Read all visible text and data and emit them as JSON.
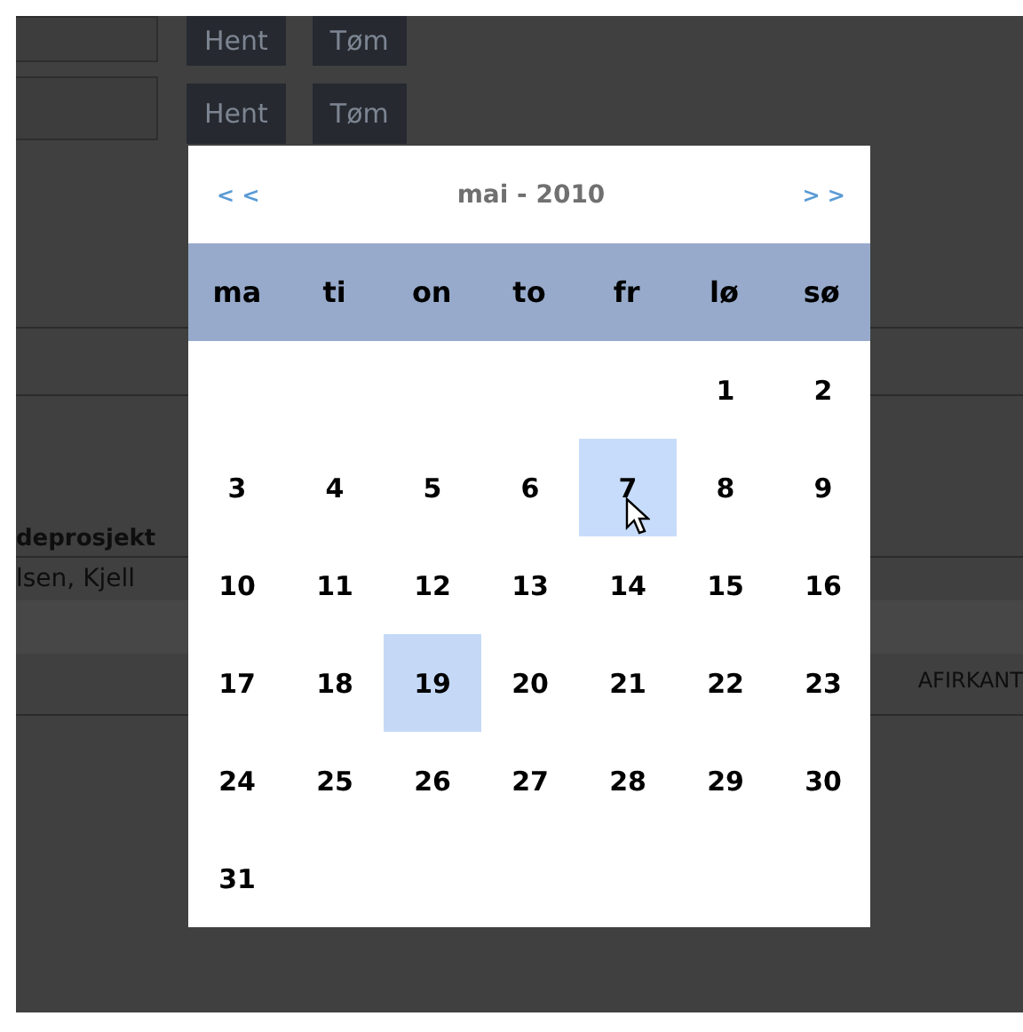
{
  "form_rows": [
    {
      "buttons": [
        "Hent",
        "Tøm"
      ]
    },
    {
      "buttons": [
        "Hent",
        "Tøm"
      ]
    }
  ],
  "background_table": {
    "header_cell": "deprosjekt",
    "cells": [
      "lsen, Kjell"
    ],
    "right_cell": "AFIRKANT"
  },
  "calendar": {
    "prev": "< <",
    "title": "mai - 2010",
    "next": "> >",
    "weekdays": [
      "ma",
      "ti",
      "on",
      "to",
      "fr",
      "lø",
      "sø"
    ],
    "weeks": [
      [
        {
          "day": "1",
          "selected": false,
          "hovered": false
        },
        {
          "day": "2",
          "selected": false,
          "hovered": false
        }
      ],
      [
        {
          "day": "3",
          "selected": false,
          "hovered": false
        },
        {
          "day": "4",
          "selected": false,
          "hovered": false
        },
        {
          "day": "5",
          "selected": false,
          "hovered": false
        },
        {
          "day": "6",
          "selected": false,
          "hovered": false
        },
        {
          "day": "7",
          "selected": false,
          "hovered": true
        },
        {
          "day": "8",
          "selected": false,
          "hovered": false
        },
        {
          "day": "9",
          "selected": false,
          "hovered": false
        }
      ],
      [
        {
          "day": "10",
          "selected": false,
          "hovered": false
        },
        {
          "day": "11",
          "selected": false,
          "hovered": false
        },
        {
          "day": "12",
          "selected": false,
          "hovered": false
        },
        {
          "day": "13",
          "selected": false,
          "hovered": false
        },
        {
          "day": "14",
          "selected": false,
          "hovered": false
        },
        {
          "day": "15",
          "selected": false,
          "hovered": false
        },
        {
          "day": "16",
          "selected": false,
          "hovered": false
        }
      ],
      [
        {
          "day": "17",
          "selected": false,
          "hovered": false
        },
        {
          "day": "18",
          "selected": false,
          "hovered": false
        },
        {
          "day": "19",
          "selected": true,
          "hovered": false
        },
        {
          "day": "20",
          "selected": false,
          "hovered": false
        },
        {
          "day": "21",
          "selected": false,
          "hovered": false
        },
        {
          "day": "22",
          "selected": false,
          "hovered": false
        },
        {
          "day": "23",
          "selected": false,
          "hovered": false
        }
      ],
      [
        {
          "day": "24",
          "selected": false,
          "hovered": false
        },
        {
          "day": "25",
          "selected": false,
          "hovered": false
        },
        {
          "day": "26",
          "selected": false,
          "hovered": false
        },
        {
          "day": "27",
          "selected": false,
          "hovered": false
        },
        {
          "day": "28",
          "selected": false,
          "hovered": false
        },
        {
          "day": "29",
          "selected": false,
          "hovered": false
        },
        {
          "day": "30",
          "selected": false,
          "hovered": false
        }
      ],
      [
        {
          "day": "31",
          "selected": false,
          "hovered": false
        }
      ]
    ]
  }
}
